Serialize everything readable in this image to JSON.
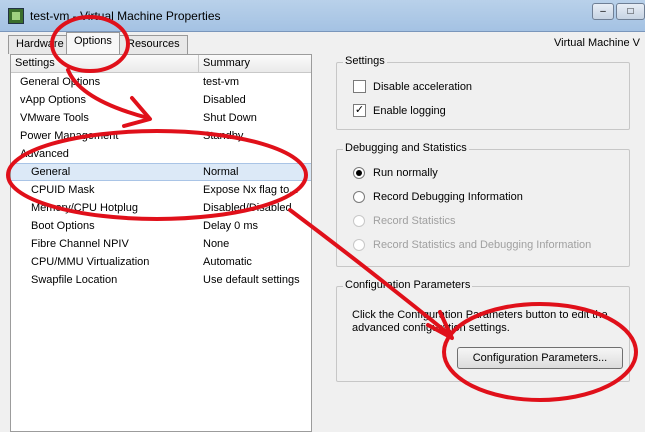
{
  "window": {
    "title": "test-vm - Virtual Machine Properties",
    "controls": {
      "minimize": "–",
      "maximize": "□",
      "close": "✕"
    }
  },
  "tabs": [
    {
      "label": "Hardware"
    },
    {
      "label": "Options"
    },
    {
      "label": "Resources"
    }
  ],
  "vm_version_label": "Virtual Machine V",
  "list": {
    "columns": [
      "Settings",
      "Summary"
    ],
    "rows": [
      {
        "setting": "General Options",
        "summary": "test-vm"
      },
      {
        "setting": "vApp Options",
        "summary": "Disabled"
      },
      {
        "setting": "VMware Tools",
        "summary": "Shut Down"
      },
      {
        "setting": "Power Management",
        "summary": "Standby"
      },
      {
        "setting": "Advanced",
        "summary": ""
      },
      {
        "setting": "General",
        "summary": "Normal"
      },
      {
        "setting": "CPUID Mask",
        "summary": "Expose Nx flag to..."
      },
      {
        "setting": "Memory/CPU Hotplug",
        "summary": "Disabled/Disabled"
      },
      {
        "setting": "Boot Options",
        "summary": "Delay 0 ms"
      },
      {
        "setting": "Fibre Channel NPIV",
        "summary": "None"
      },
      {
        "setting": "CPU/MMU Virtualization",
        "summary": "Automatic"
      },
      {
        "setting": "Swapfile Location",
        "summary": "Use default settings"
      }
    ]
  },
  "settings_group": {
    "title": "Settings",
    "options": [
      {
        "label": "Disable acceleration",
        "checked": false
      },
      {
        "label": "Enable logging",
        "checked": true
      }
    ]
  },
  "debug_group": {
    "title": "Debugging and Statistics",
    "options": [
      {
        "label": "Run normally",
        "selected": true,
        "enabled": true
      },
      {
        "label": "Record Debugging Information",
        "selected": false,
        "enabled": true
      },
      {
        "label": "Record Statistics",
        "selected": false,
        "enabled": false
      },
      {
        "label": "Record Statistics and Debugging Information",
        "selected": false,
        "enabled": false
      }
    ]
  },
  "config_group": {
    "title": "Configuration Parameters",
    "description": "Click the Configuration Parameters button to edit the advanced configuration settings.",
    "button_label": "Configuration Parameters..."
  },
  "annotation_color": "#e0101a"
}
